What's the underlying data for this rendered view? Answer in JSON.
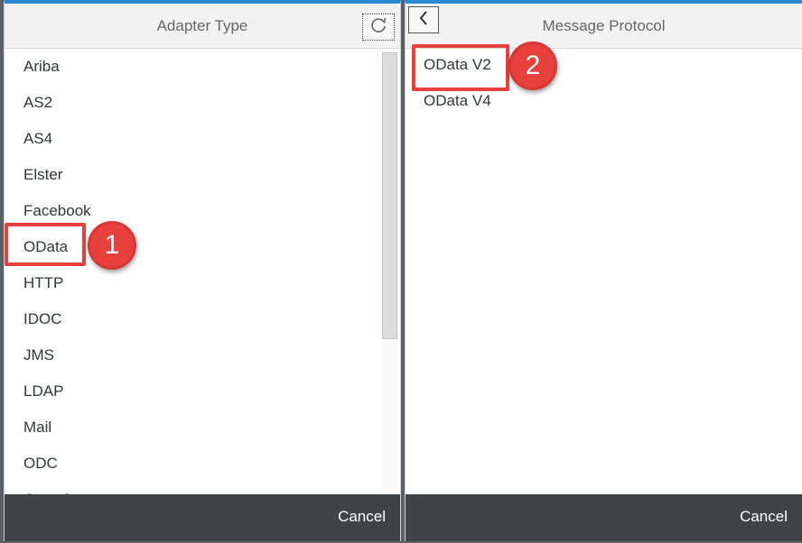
{
  "left_dialog": {
    "title": "Adapter Type",
    "refresh_icon": "refresh-icon",
    "items": [
      {
        "label": "Ariba"
      },
      {
        "label": "AS2"
      },
      {
        "label": "AS4"
      },
      {
        "label": "Elster"
      },
      {
        "label": "Facebook"
      },
      {
        "label": "OData"
      },
      {
        "label": "HTTP"
      },
      {
        "label": "IDOC"
      },
      {
        "label": "JMS"
      },
      {
        "label": "LDAP"
      },
      {
        "label": "Mail"
      },
      {
        "label": "ODC"
      },
      {
        "label": "OpenConnectors"
      }
    ],
    "cancel_label": "Cancel"
  },
  "right_dialog": {
    "title": "Message Protocol",
    "back_icon": "chevron-left-icon",
    "items": [
      {
        "label": "OData V2"
      },
      {
        "label": "OData V4"
      }
    ],
    "cancel_label": "Cancel"
  },
  "annotations": {
    "step1": "1",
    "step2": "2",
    "highlight_color": "#e8403c"
  },
  "colors": {
    "header_accent": "#2a8ad4",
    "footer_bg": "#3f4448",
    "header_bg": "#f2f2f2"
  }
}
